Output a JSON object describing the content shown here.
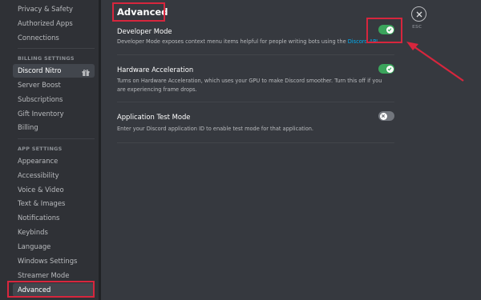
{
  "sidebar": {
    "top_items": [
      {
        "label": "Privacy & Safety"
      },
      {
        "label": "Authorized Apps"
      },
      {
        "label": "Connections"
      }
    ],
    "billing_header": "BILLING SETTINGS",
    "billing_items": [
      {
        "label": "Discord Nitro",
        "icon": "gift-icon"
      },
      {
        "label": "Server Boost"
      },
      {
        "label": "Subscriptions"
      },
      {
        "label": "Gift Inventory"
      },
      {
        "label": "Billing"
      }
    ],
    "app_header": "APP SETTINGS",
    "app_items": [
      {
        "label": "Appearance"
      },
      {
        "label": "Accessibility"
      },
      {
        "label": "Voice & Video"
      },
      {
        "label": "Text & Images"
      },
      {
        "label": "Notifications"
      },
      {
        "label": "Keybinds"
      },
      {
        "label": "Language"
      },
      {
        "label": "Windows Settings"
      },
      {
        "label": "Streamer Mode"
      },
      {
        "label": "Advanced"
      }
    ]
  },
  "main": {
    "title": "Advanced",
    "settings": [
      {
        "title": "Developer Mode",
        "desc_before": "Developer Mode exposes context menu items helpful for people writing bots using the ",
        "desc_link": "Discord API",
        "desc_after": ".",
        "enabled": true
      },
      {
        "title": "Hardware Acceleration",
        "desc": "Turns on Hardware Acceleration, which uses your GPU to make Discord smoother. Turn this off if you are experiencing frame drops.",
        "enabled": true
      },
      {
        "title": "Application Test Mode",
        "desc": "Enter your Discord application ID to enable test mode for that application.",
        "enabled": false
      }
    ]
  },
  "close": {
    "label": "ESC",
    "icon": "close-icon"
  },
  "colors": {
    "background": "#36393f",
    "sidebar": "#2f3136",
    "toggle_on": "#3ba55c",
    "toggle_off": "#72767d",
    "link": "#00aff4",
    "annotation": "#d7263d"
  }
}
